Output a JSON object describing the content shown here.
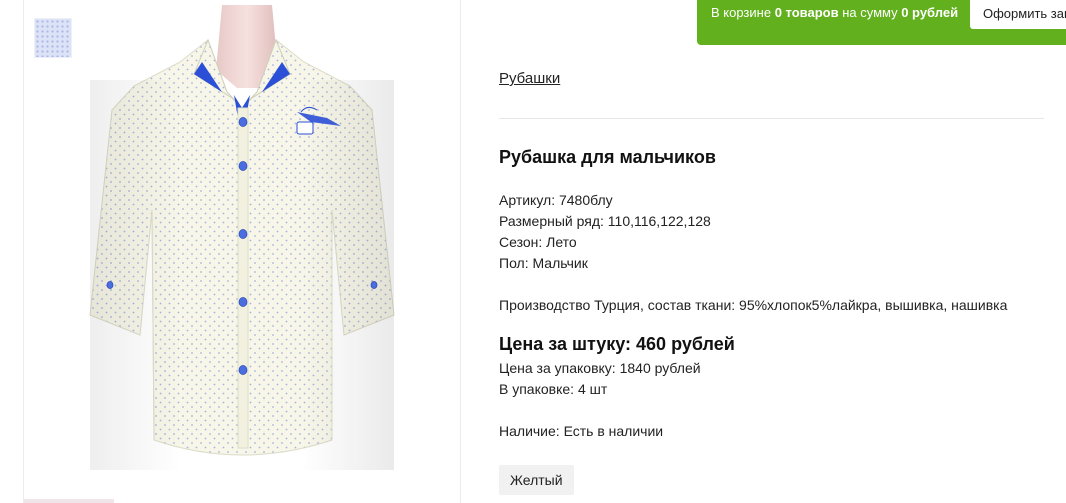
{
  "cart": {
    "prefix": "В корзине ",
    "count": "0 товаров",
    "middle": " на сумму ",
    "sum": "0 рублей",
    "checkout_label": "Оформить зак",
    "color": "#62b01e"
  },
  "breadcrumb": {
    "category": "Рубашки"
  },
  "product": {
    "title": "Рубашка для мальчиков",
    "specs": [
      "Артикул: 7480блу",
      "Размерный ряд: 110,116,122,128",
      "Сезон: Лето",
      "Пол: Мальчик"
    ],
    "composition": "Производство Турция, состав ткани: 95%хлопок5%лайкра, вышивка, нашивка",
    "price_unit": "Цена за штуку: 460 рублей",
    "price_pack": "Цена за упаковку: 1840 рублей",
    "pack_qty": "В упаковке: 4 шт",
    "availability": "Наличие: Есть в наличии",
    "colors": [
      "Желтый"
    ]
  },
  "gallery": {
    "main_image": "shirt-photo",
    "thumbnail": "shirt-thumbnail"
  }
}
